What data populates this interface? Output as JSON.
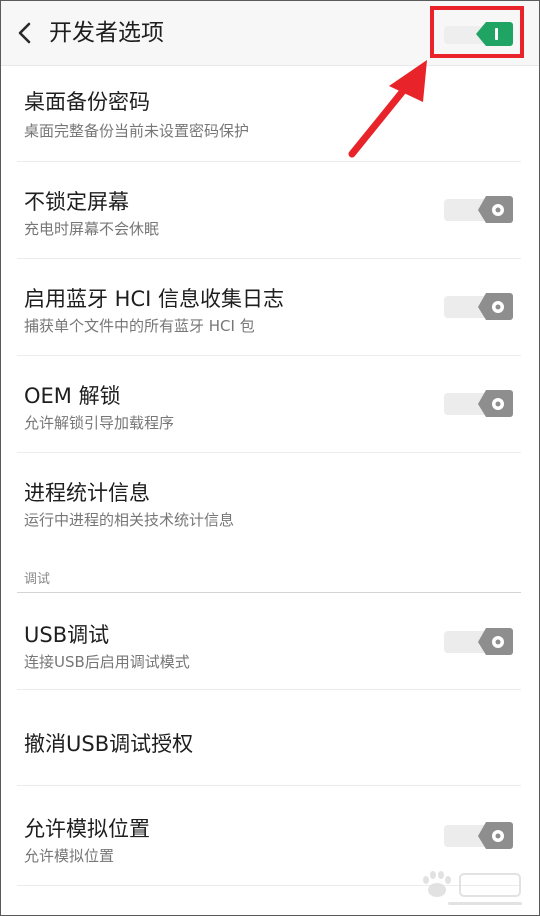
{
  "header": {
    "title": "开发者选项",
    "master_switch_on": true,
    "master_switch_color": "#1fa463"
  },
  "settings": [
    {
      "title": "桌面备份密码",
      "subtitle": "桌面完整备份当前未设置密码保护",
      "has_toggle": false
    },
    {
      "title": "不锁定屏幕",
      "subtitle": "充电时屏幕不会休眠",
      "has_toggle": true,
      "on": false
    },
    {
      "title": "启用蓝牙 HCI 信息收集日志",
      "subtitle": "捕获单个文件中的所有蓝牙 HCI 包",
      "has_toggle": true,
      "on": false
    },
    {
      "title": "OEM 解锁",
      "subtitle": "允许解锁引导加载程序",
      "has_toggle": true,
      "on": false
    },
    {
      "title": "进程统计信息",
      "subtitle": "运行中进程的相关技术统计信息",
      "has_toggle": false
    }
  ],
  "debug_section": {
    "label": "调试",
    "items": [
      {
        "title": "USB调试",
        "subtitle": "连接USB后启用调试模式",
        "has_toggle": true,
        "on": false
      },
      {
        "title": "撤消USB调试授权",
        "has_toggle": false
      },
      {
        "title": "允许模拟位置",
        "subtitle": "允许模拟位置",
        "has_toggle": true,
        "on": false
      }
    ]
  },
  "colors": {
    "accent_on": "#1fa463",
    "toggle_off_track": "#ececec",
    "toggle_off_thumb": "#8e8e8e",
    "highlight": "#e8232a"
  },
  "icons": {
    "back": "chevron-left-icon",
    "annotation": "red-arrow-icon",
    "watermark": "baidu-jingyan-watermark"
  }
}
